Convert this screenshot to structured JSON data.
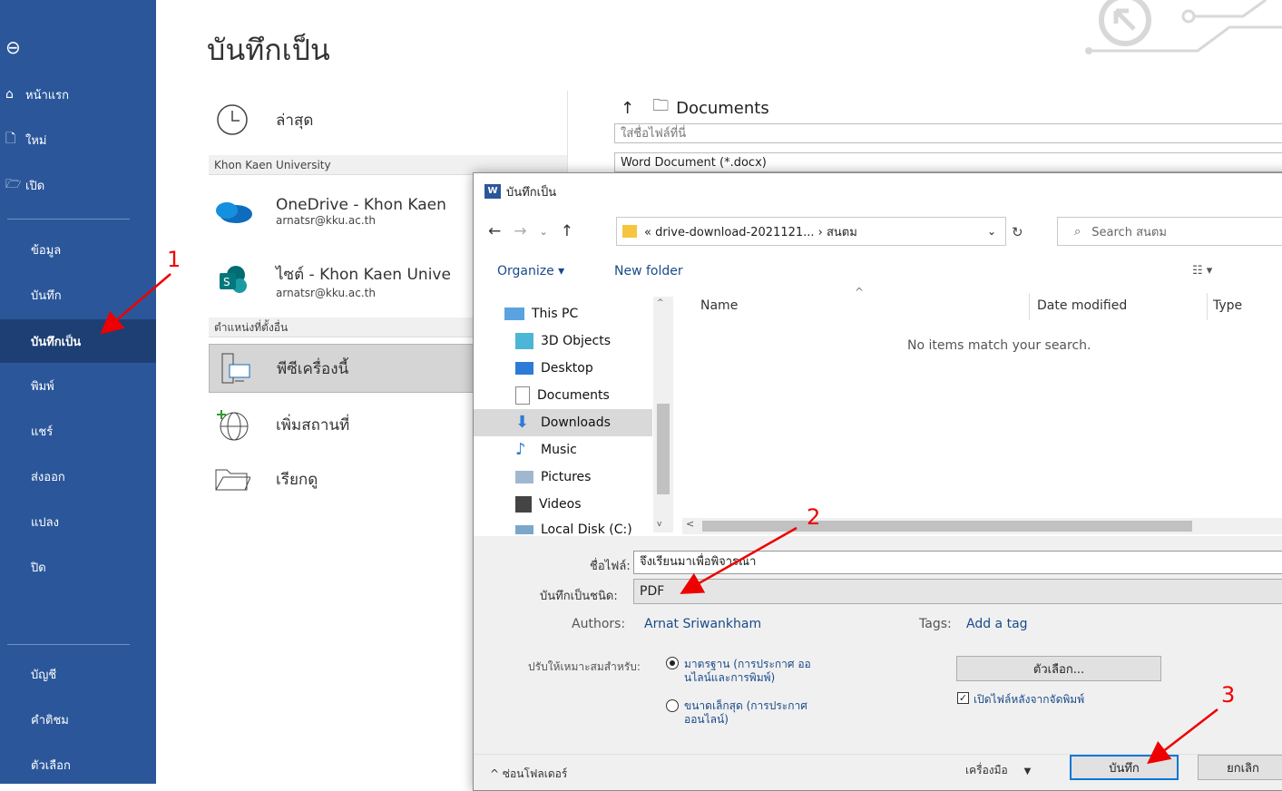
{
  "nav": {
    "back": "back",
    "items": [
      {
        "label": "หน้าแรก",
        "icon": "home-icon"
      },
      {
        "label": "ใหม่",
        "icon": "new-doc-icon"
      },
      {
        "label": "เปิด",
        "icon": "folder-open-icon"
      }
    ],
    "mid": [
      "ข้อมูล",
      "บันทึก",
      "บันทึกเป็น",
      "พิมพ์",
      "แชร์",
      "ส่งออก",
      "แปลง",
      "ปิด"
    ],
    "bottom": [
      "บัญชี",
      "คำติชม",
      "ตัวเลือก"
    ]
  },
  "backstage": {
    "title": "บันทึกเป็น",
    "recent": "ล่าสุด",
    "group1": "Khon Kaen University",
    "onedrive_name": "OneDrive - Khon Kaen",
    "onedrive_mail": "arnatsr@kku.ac.th",
    "site_name": "ไซต์ - Khon Kaen Unive",
    "site_mail": "arnatsr@kku.ac.th",
    "group2": "ตำแหน่งที่ตั้งอื่น",
    "this_pc": "พีซีเครื่องนี้",
    "add_place": "เพิ่มสถานที่",
    "browse": "เรียกดู",
    "path_folder": "Documents",
    "filename_placeholder": "ใส่ชื่อไฟล์ที่นี่",
    "filetype": "Word Document (*.docx)"
  },
  "dialog": {
    "title": "บันทึกเป็น",
    "address": "« drive-download-2021121... › สนตม",
    "search_placeholder": "Search สนตม",
    "organize": "Organize ▾",
    "new_folder": "New folder",
    "tree": [
      "This PC",
      "3D Objects",
      "Desktop",
      "Documents",
      "Downloads",
      "Music",
      "Pictures",
      "Videos",
      "Local Disk (C:)"
    ],
    "col_name": "Name",
    "col_date": "Date modified",
    "col_type": "Type",
    "empty": "No items match your search.",
    "filename_label": "ชื่อไฟล์:",
    "filename_value": "จึงเรียนมาเพื่อพิจารณา",
    "type_label": "บันทึกเป็นชนิด:",
    "type_value": "PDF",
    "authors_label": "Authors:",
    "authors_value": "Arnat Sriwankham",
    "tags_label": "Tags:",
    "tags_value": "Add a tag",
    "optimize_label": "ปรับให้เหมาะสมสำหรับ:",
    "opt1_line1": "มาตรฐาน (การประกาศ ออ",
    "opt1_line2": "นไลน์และการพิมพ์)",
    "opt2_line1": "ขนาดเล็กสุด (การประกาศ",
    "opt2_line2": "ออนไลน์)",
    "options_btn": "ตัวเลือก...",
    "open_after": "เปิดไฟล์หลังจากจัดพิมพ์",
    "hide_folders": "ซ่อนโฟลเดอร์",
    "tools": "เครื่องมือ",
    "save": "บันทึก",
    "cancel": "ยกเลิก"
  },
  "annotations": [
    "1",
    "2",
    "3"
  ],
  "colors": {
    "nav_bg": "#2b579a",
    "nav_sel": "#1e3f73",
    "arrow": "#e00000"
  }
}
